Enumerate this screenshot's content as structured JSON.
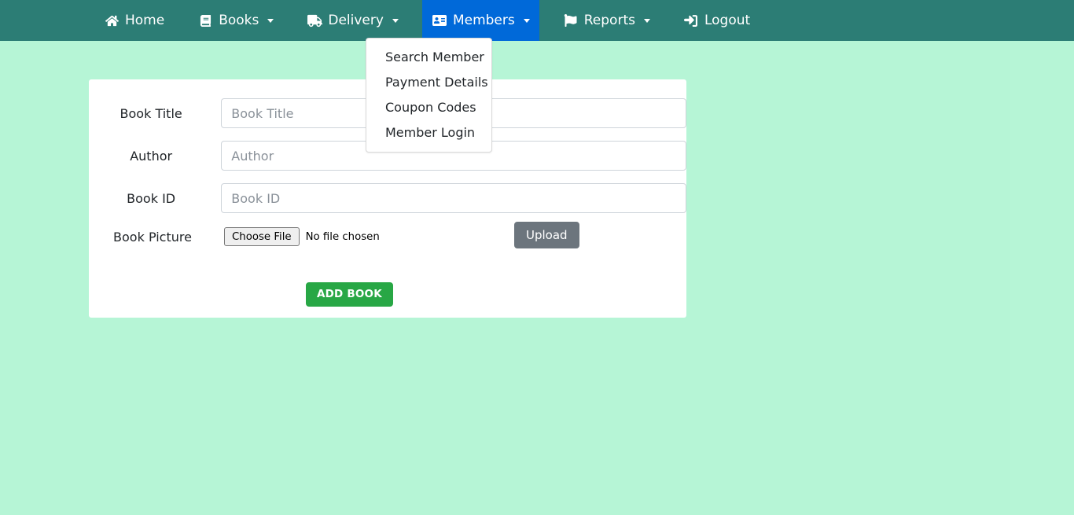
{
  "theme": {
    "navbar_bg": "#2c7d75",
    "body_bg": "#b6f5d6",
    "active_nav_bg": "#0069d9",
    "primary_button_bg": "#28a745",
    "secondary_button_bg": "#6c757d",
    "card_bg": "#ffffff"
  },
  "navbar": {
    "items": [
      {
        "label": "Home",
        "icon": "home-icon",
        "has_caret": false,
        "active": false
      },
      {
        "label": "Books",
        "icon": "book-icon",
        "has_caret": true,
        "active": false
      },
      {
        "label": "Delivery",
        "icon": "truck-icon",
        "has_caret": true,
        "active": false
      },
      {
        "label": "Members",
        "icon": "address-card-icon",
        "has_caret": true,
        "active": true
      },
      {
        "label": "Reports",
        "icon": "flag-icon",
        "has_caret": true,
        "active": false
      },
      {
        "label": "Logout",
        "icon": "sign-out-icon",
        "has_caret": false,
        "active": false
      }
    ]
  },
  "members_dropdown": {
    "open": true,
    "items": [
      {
        "label": "Search Member"
      },
      {
        "label": "Payment Details"
      },
      {
        "label": "Coupon Codes"
      },
      {
        "label": "Member Login"
      }
    ]
  },
  "form": {
    "fields": [
      {
        "label": "Book Title",
        "placeholder": "Book Title",
        "value": ""
      },
      {
        "label": "Author",
        "placeholder": "Author",
        "value": ""
      },
      {
        "label": "Book ID",
        "placeholder": "Book ID",
        "value": ""
      }
    ],
    "picture": {
      "label": "Book Picture",
      "choose_file_label": "Choose File",
      "file_status": "No file chosen",
      "upload_label": "Upload"
    },
    "submit_label": "ADD BOOK"
  }
}
